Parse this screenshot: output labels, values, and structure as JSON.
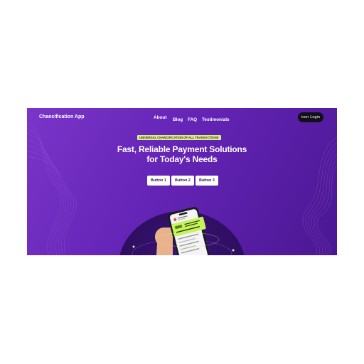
{
  "app": {
    "brand": "Chancification App"
  },
  "nav": {
    "about": "About",
    "blog": "Blog",
    "faq": "FAQ",
    "testimonials": "Testimonials"
  },
  "login": {
    "icon_text": "icon",
    "label": "Login"
  },
  "hero": {
    "badge": "UNIVERSAL CHANCIFICATION OF ALL TRANSACTIONS",
    "headline_line1": "Fast, Reliable Payment Solutions",
    "headline_line2": "for Today's Needs"
  },
  "buttons": {
    "b1": "Button 1",
    "b2": "Button 2",
    "b3": "Button 3"
  },
  "colors": {
    "hero_start": "#7a35c9",
    "hero_end": "#4a1792",
    "badge_bg": "#d9f07a",
    "login_bg": "#111018",
    "card_green": "#c6f25c"
  },
  "illustration": {
    "subject": "hand-holding-phone-with-card"
  }
}
